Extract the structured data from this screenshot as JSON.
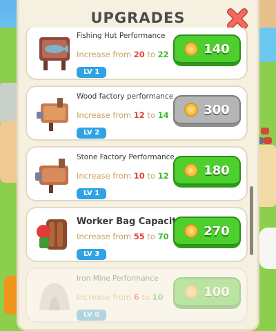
{
  "panel": {
    "title": "UPGRADES",
    "close_icon": "close-x-icon",
    "accent_close": "#f26a5e"
  },
  "colors": {
    "green_button": "#4dcf2e",
    "gray_button": "#b5b5b5",
    "level_badge": "#2fa3e4",
    "from_value": "#e0453c",
    "to_value": "#3fb92a"
  },
  "upgrades": [
    {
      "name": "Fishing Hut Performance",
      "increase_prefix": "Increase from",
      "from": "20",
      "connector": "to",
      "to": "22",
      "level": "LV 1",
      "price": "140",
      "state": "available",
      "icon": "fishing-hut-icon"
    },
    {
      "name": "Wood factory performance",
      "increase_prefix": "Increase from",
      "from": "12",
      "connector": "to",
      "to": "14",
      "level": "LV 2",
      "price": "300",
      "state": "unaffordable",
      "icon": "wood-factory-icon"
    },
    {
      "name": "Stone Factory Performance",
      "increase_prefix": "Increase from",
      "from": "10",
      "connector": "to",
      "to": "12",
      "level": "LV 1",
      "price": "180",
      "state": "available",
      "icon": "stone-factory-icon"
    },
    {
      "name": "Worker Bag Capacity",
      "increase_prefix": "Increase from",
      "from": "55",
      "connector": "to",
      "to": "70",
      "level": "LV 3",
      "price": "270",
      "state": "available",
      "icon": "worker-bag-icon"
    },
    {
      "name": "Iron Mine Performance",
      "increase_prefix": "Increase from",
      "from": "6",
      "connector": "to",
      "to": "10",
      "level": "LV 0",
      "price": "100",
      "state": "locked",
      "icon": "iron-mine-icon"
    }
  ]
}
